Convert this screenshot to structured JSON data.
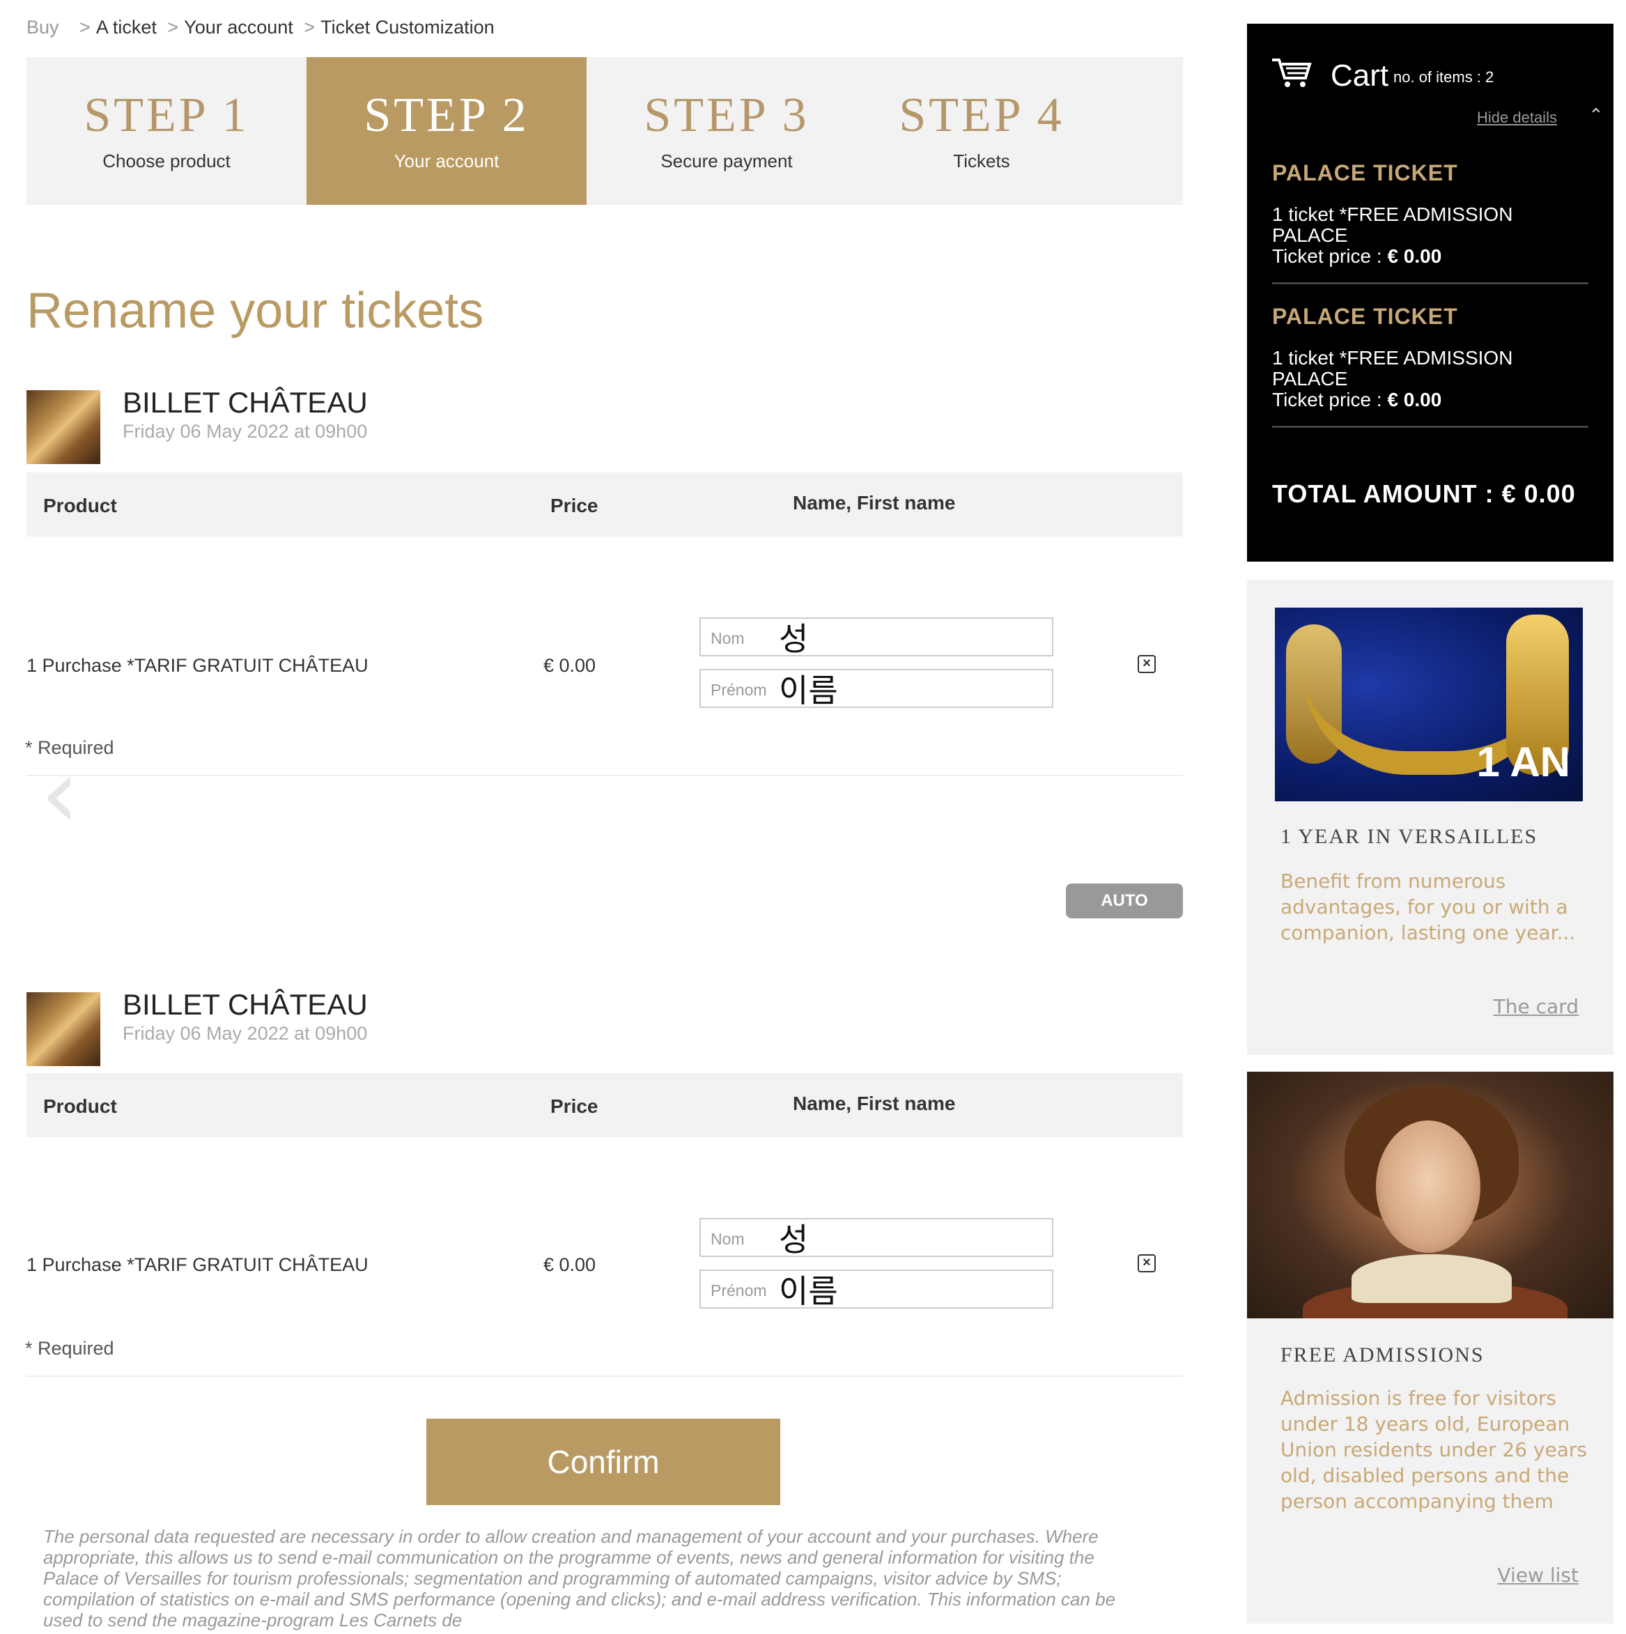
{
  "breadcrumb": {
    "items": [
      "Buy",
      "A ticket",
      "Your account",
      "Ticket Customization"
    ],
    "separator": ">"
  },
  "steps": [
    {
      "label": "STEP 1",
      "sub": "Choose product",
      "active": false
    },
    {
      "label": "STEP 2",
      "sub": "Your account",
      "active": true
    },
    {
      "label": "STEP 3",
      "sub": "Secure payment",
      "active": false
    },
    {
      "label": "STEP 4",
      "sub": "Tickets",
      "active": false
    }
  ],
  "page_title": "Rename your tickets",
  "table_headers": {
    "product": "Product",
    "price": "Price",
    "name": "Name, First name"
  },
  "tickets": [
    {
      "title": "BILLET CHÂTEAU",
      "date": "Friday 06 May 2022 at 09h00",
      "product": "1 Purchase *TARIF GRATUIT CHÂTEAU",
      "price": "€ 0.00",
      "nom_placeholder": "Nom",
      "nom_value": "성",
      "prenom_placeholder": "Prénom",
      "prenom_value": "이름",
      "remove_icon": "close-box-icon",
      "required_note": "* Required"
    },
    {
      "title": "BILLET CHÂTEAU",
      "date": "Friday 06 May 2022 at 09h00",
      "product": "1 Purchase *TARIF GRATUIT CHÂTEAU",
      "price": "€ 0.00",
      "nom_placeholder": "Nom",
      "nom_value": "성",
      "prenom_placeholder": "Prénom",
      "prenom_value": "이름",
      "remove_icon": "close-box-icon",
      "required_note": "* Required"
    }
  ],
  "auto_button": "AUTO",
  "confirm_button": "Confirm",
  "legal_text": "The personal data requested are necessary in order to allow creation and management of your account and your purchases. Where appropriate, this allows us to send e-mail communication on the programme of events, news and general information for visiting the Palace of Versailles for tourism professionals; segmentation and programming of automated campaigns, visitor advice by SMS; compilation of statistics on e-mail and SMS performance (opening and clicks); and e-mail address verification. This information can be used to send the magazine-program Les Carnets de",
  "cart": {
    "label": "Cart",
    "count_text": "no. of items : 2",
    "hide_details": "Hide details",
    "items": [
      {
        "title": "PALACE TICKET",
        "desc": "1 ticket *FREE ADMISSION PALACE",
        "price_label": "Ticket price : ",
        "price": "€ 0.00"
      },
      {
        "title": "PALACE TICKET",
        "desc": "1 ticket *FREE ADMISSION PALACE",
        "price_label": "Ticket price : ",
        "price": "€ 0.00"
      }
    ],
    "total": "TOTAL AMOUNT : € 0.00"
  },
  "promos": [
    {
      "image_badge": "1 AN",
      "title": "1 YEAR IN VERSAILLES",
      "text": "Benefit from numerous advantages, for you or with a companion, lasting one year...",
      "link": "The card"
    },
    {
      "title": "FREE ADMISSIONS",
      "text": "Admission is free for visitors under 18 years old, European Union residents under 26 years old, disabled persons and the person accompanying them",
      "link": "View list"
    }
  ],
  "colors": {
    "accent": "#b99a62",
    "cart_bg": "#000000",
    "cart_title": "#c9a877",
    "panel_bg": "#f2f2f2"
  }
}
